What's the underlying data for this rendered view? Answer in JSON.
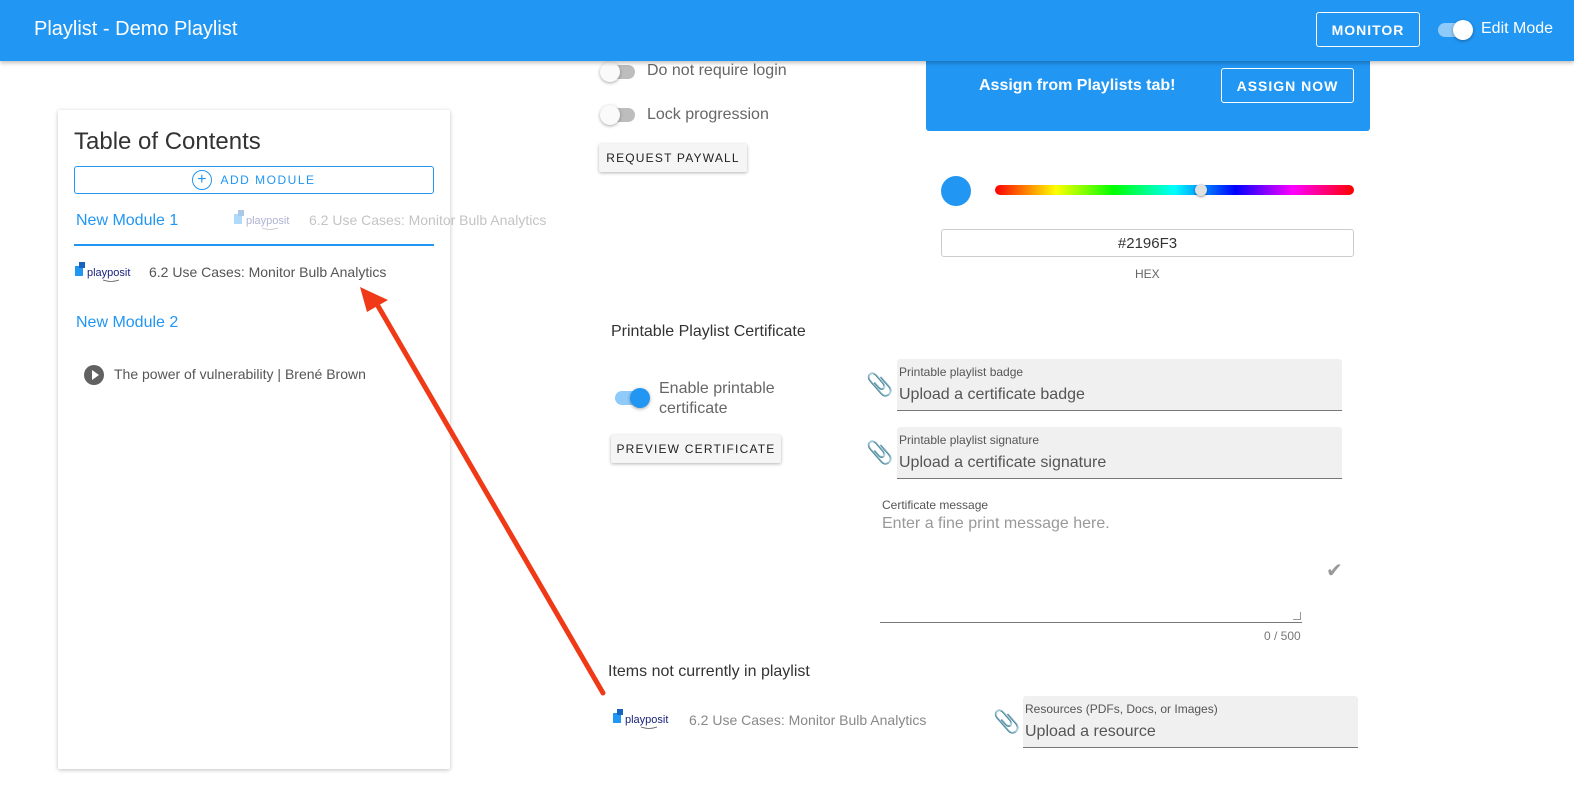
{
  "appbar": {
    "title": "Playlist - Demo Playlist",
    "monitor_label": "MONITOR",
    "edit_mode_label": "Edit Mode"
  },
  "toc": {
    "title": "Table of Contents",
    "add_module_label": "ADD MODULE",
    "modules": [
      {
        "title": "New Module 1",
        "items": [
          {
            "title": "6.2 Use Cases: Monitor Bulb Analytics",
            "icon": "playposit-logo"
          }
        ]
      },
      {
        "title": "New Module 2",
        "items": [
          {
            "title": "The power of vulnerability | Brené Brown",
            "icon": "play-circle-icon"
          }
        ]
      }
    ],
    "dragging_item": "6.2 Use Cases: Monitor Bulb Analytics",
    "logo_text": "playposit"
  },
  "settings": {
    "no_login_label": "Do not require login",
    "lock_progression_label": "Lock progression",
    "request_paywall_label": "REQUEST PAYWALL"
  },
  "assign": {
    "text": "Assign from Playlists tab!",
    "button_label": "ASSIGN NOW"
  },
  "color": {
    "hex_value": "#2196F3",
    "hex_label": "HEX",
    "accent": "#2196F3"
  },
  "certificate": {
    "title": "Printable Playlist Certificate",
    "enable_label": "Enable printable certificate",
    "preview_label": "PREVIEW CERTIFICATE",
    "badge_caption": "Printable playlist badge",
    "badge_value": "Upload a certificate badge",
    "signature_caption": "Printable playlist signature",
    "signature_value": "Upload a certificate signature",
    "message_caption": "Certificate message",
    "message_placeholder": "Enter a fine print message here.",
    "counter": "0 / 500"
  },
  "not_in_playlist": {
    "title": "Items not currently in playlist",
    "items": [
      {
        "title": "6.2 Use Cases: Monitor Bulb Analytics"
      }
    ],
    "resource_caption": "Resources (PDFs, Docs, or Images)",
    "resource_value": "Upload a resource"
  },
  "annotation": {
    "arrow_color": "#f03a17"
  }
}
